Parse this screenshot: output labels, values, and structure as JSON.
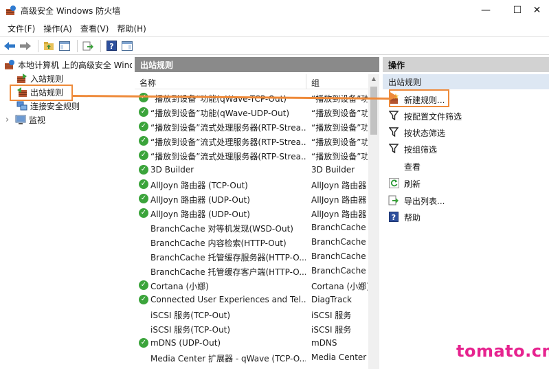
{
  "window": {
    "title": "高级安全 Windows 防火墙",
    "minimize_glyph": "—",
    "maximize_glyph": "☐",
    "close_glyph": "✕"
  },
  "menu": [
    "文件(F)",
    "操作(A)",
    "查看(V)",
    "帮助(H)"
  ],
  "tree": {
    "root": "本地计算机 上的高级安全 Windows",
    "items": [
      "入站规则",
      "出站规则",
      "连接安全规则",
      "监视"
    ],
    "expander_glyph": "›"
  },
  "middle": {
    "header": "出站规则",
    "columns": {
      "name": "名称",
      "group": "组"
    },
    "rows": [
      {
        "enabled": true,
        "name": "“播放到设备”功能(qWave-TCP-Out)",
        "group": "“播放到设备”功"
      },
      {
        "enabled": true,
        "name": "“播放到设备”功能(qWave-UDP-Out)",
        "group": "“播放到设备”功"
      },
      {
        "enabled": true,
        "name": "“播放到设备”流式处理服务器(RTP-Strea...",
        "group": "“播放到设备”功"
      },
      {
        "enabled": true,
        "name": "“播放到设备”流式处理服务器(RTP-Strea...",
        "group": "“播放到设备”功"
      },
      {
        "enabled": true,
        "name": "“播放到设备”流式处理服务器(RTP-Strea...",
        "group": "“播放到设备”功"
      },
      {
        "enabled": true,
        "name": "3D Builder",
        "group": "3D Builder"
      },
      {
        "enabled": true,
        "name": "AllJoyn 路由器 (TCP-Out)",
        "group": "AllJoyn 路由器"
      },
      {
        "enabled": true,
        "name": "AllJoyn 路由器 (UDP-Out)",
        "group": "AllJoyn 路由器"
      },
      {
        "enabled": true,
        "name": "AllJoyn 路由器 (UDP-Out)",
        "group": "AllJoyn 路由器"
      },
      {
        "enabled": false,
        "name": "BranchCache 对等机发现(WSD-Out)",
        "group": "BranchCache -"
      },
      {
        "enabled": false,
        "name": "BranchCache 内容检索(HTTP-Out)",
        "group": "BranchCache -"
      },
      {
        "enabled": false,
        "name": "BranchCache 托管缓存服务器(HTTP-O...",
        "group": "BranchCache -"
      },
      {
        "enabled": false,
        "name": "BranchCache 托管缓存客户端(HTTP-O...",
        "group": "BranchCache -"
      },
      {
        "enabled": true,
        "name": "Cortana (小娜)",
        "group": "Cortana (小娜)"
      },
      {
        "enabled": true,
        "name": "Connected User Experiences and Tel...",
        "group": "DiagTrack"
      },
      {
        "enabled": false,
        "name": "iSCSI 服务(TCP-Out)",
        "group": "iSCSI 服务"
      },
      {
        "enabled": false,
        "name": "iSCSI 服务(TCP-Out)",
        "group": "iSCSI 服务"
      },
      {
        "enabled": true,
        "name": "mDNS (UDP-Out)",
        "group": "mDNS"
      },
      {
        "enabled": false,
        "name": "Media Center 扩展器 - qWave (TCP-O...",
        "group": "Media Center"
      }
    ]
  },
  "actions": {
    "header": "操作",
    "section": "出站规则",
    "items": [
      {
        "label": "新建规则...",
        "icon": "new-rule-icon"
      },
      {
        "label": "按配置文件筛选",
        "icon": "filter-icon"
      },
      {
        "label": "按状态筛选",
        "icon": "filter-icon"
      },
      {
        "label": "按组筛选",
        "icon": "filter-icon"
      },
      {
        "label": "查看",
        "icon": "none"
      },
      {
        "label": "刷新",
        "icon": "refresh-icon"
      },
      {
        "label": "导出列表...",
        "icon": "export-icon"
      },
      {
        "label": "帮助",
        "icon": "help-icon"
      }
    ]
  },
  "colors": {
    "highlight": "#ee8a3a",
    "watermark": "#e6238f",
    "enabled_green": "#3ba43b"
  },
  "watermark": "tomato.cm"
}
